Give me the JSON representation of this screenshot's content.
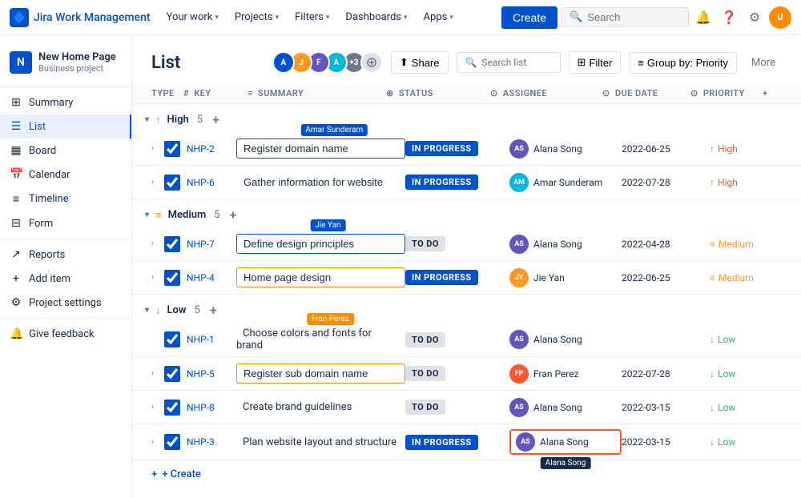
{
  "nav": {
    "brand": "Jira Work Management",
    "items": [
      "Your work",
      "Projects",
      "Filters",
      "Dashboards",
      "Apps"
    ],
    "create_label": "Create",
    "search_placeholder": "Search"
  },
  "sidebar": {
    "project_name": "New Home Page",
    "project_type": "Business project",
    "items": [
      {
        "id": "summary",
        "label": "Summary",
        "icon": "⊞"
      },
      {
        "id": "list",
        "label": "List",
        "icon": "☰"
      },
      {
        "id": "board",
        "label": "Board",
        "icon": "▦"
      },
      {
        "id": "calendar",
        "label": "Calendar",
        "icon": "📅"
      },
      {
        "id": "timeline",
        "label": "Timeline",
        "icon": "≡"
      },
      {
        "id": "form",
        "label": "Form",
        "icon": "⊟"
      },
      {
        "id": "reports",
        "label": "Reports",
        "icon": "↗"
      },
      {
        "id": "add-item",
        "label": "Add item",
        "icon": "+"
      },
      {
        "id": "project-settings",
        "label": "Project settings",
        "icon": "⚙"
      },
      {
        "id": "give-feedback",
        "label": "Give feedback",
        "icon": "🔔"
      }
    ]
  },
  "page": {
    "title": "List",
    "search_list_placeholder": "Search list",
    "filter_label": "Filter",
    "group_by_label": "Group by: Priority",
    "more_label": "More",
    "share_label": "Share"
  },
  "groups": [
    {
      "id": "high",
      "label": "High",
      "count": 5,
      "icon": "↑",
      "color": "#FF5630",
      "rows": [
        {
          "key": "NHP-2",
          "summary": "Register domain name",
          "status": "IN PROGRESS",
          "status_type": "inprogress",
          "assignee": "Alana Song",
          "assignee_color": "#6554C0",
          "assignee_initials": "AS",
          "due_date": "2022-06-25",
          "priority": "High",
          "priority_type": "high",
          "has_tooltip": true,
          "tooltip_text": "Amar Sunderam",
          "tooltip_color": "blue",
          "input_border": "blue"
        },
        {
          "key": "NHP-6",
          "summary": "Gather information for website",
          "status": "IN PROGRESS",
          "status_type": "inprogress",
          "assignee": "Amar Sunderam",
          "assignee_color": "#00B8D9",
          "assignee_initials": "AM",
          "due_date": "2022-07-28",
          "priority": "High",
          "priority_type": "high",
          "has_tooltip": false,
          "input_border": "none"
        }
      ]
    },
    {
      "id": "medium",
      "label": "Medium",
      "count": 5,
      "icon": "≡",
      "color": "#FF991F",
      "rows": [
        {
          "key": "NHP-7",
          "summary": "Define design principles",
          "status": "TO DO",
          "status_type": "todo",
          "assignee": "Alana Song",
          "assignee_color": "#6554C0",
          "assignee_initials": "AS",
          "due_date": "2022-04-28",
          "priority": "Medium",
          "priority_type": "medium",
          "has_tooltip": true,
          "tooltip_text": "Jie Yan",
          "tooltip_color": "blue",
          "input_border": "blue"
        },
        {
          "key": "NHP-4",
          "summary": "Home page design",
          "status": "IN PROGRESS",
          "status_type": "inprogress",
          "assignee": "Jie Yan",
          "assignee_color": "#FF991F",
          "assignee_initials": "JY",
          "due_date": "2022-06-25",
          "priority": "Medium",
          "priority_type": "medium",
          "has_tooltip": false,
          "input_border": "orange"
        }
      ]
    },
    {
      "id": "low",
      "label": "Low",
      "count": 5,
      "icon": "↓",
      "color": "#36B37E",
      "rows": [
        {
          "key": "NHP-1",
          "summary": "Choose colors and fonts for brand",
          "status": "TO DO",
          "status_type": "todo",
          "assignee": "Alana Song",
          "assignee_color": "#6554C0",
          "assignee_initials": "AS",
          "due_date": "",
          "priority": "Low",
          "priority_type": "low",
          "has_tooltip": true,
          "tooltip_text": "Fran Perez",
          "tooltip_color": "orange",
          "input_border": "none"
        },
        {
          "key": "NHP-5",
          "summary": "Register sub domain name",
          "status": "TO DO",
          "status_type": "todo",
          "assignee": "Fran Perez",
          "assignee_color": "#FF5630",
          "assignee_initials": "FP",
          "due_date": "2022-07-28",
          "priority": "Low",
          "priority_type": "low",
          "has_tooltip": false,
          "input_border": "orange"
        },
        {
          "key": "NHP-8",
          "summary": "Create brand guidelines",
          "status": "TO DO",
          "status_type": "todo",
          "assignee": "Alana Song",
          "assignee_color": "#6554C0",
          "assignee_initials": "AS",
          "due_date": "2022-03-15",
          "priority": "Low",
          "priority_type": "low",
          "has_tooltip": false,
          "input_border": "none"
        },
        {
          "key": "NHP-3",
          "summary": "Plan website layout and structure",
          "status": "IN PROGRESS",
          "status_type": "inprogress",
          "assignee": "Alana Song",
          "assignee_color": "#6554C0",
          "assignee_initials": "AS",
          "due_date": "2022-03-15",
          "priority": "Low",
          "priority_type": "low",
          "has_tooltip": false,
          "assignee_highlight": true,
          "assignee_tooltip": "Alana Song",
          "input_border": "none"
        }
      ]
    }
  ],
  "create_label": "+ Create",
  "col_headers": {
    "type": "Type",
    "key": "Key",
    "summary": "Summary",
    "status": "Status",
    "assignee": "Assignee",
    "due_date": "Due date",
    "priority": "Priority"
  }
}
